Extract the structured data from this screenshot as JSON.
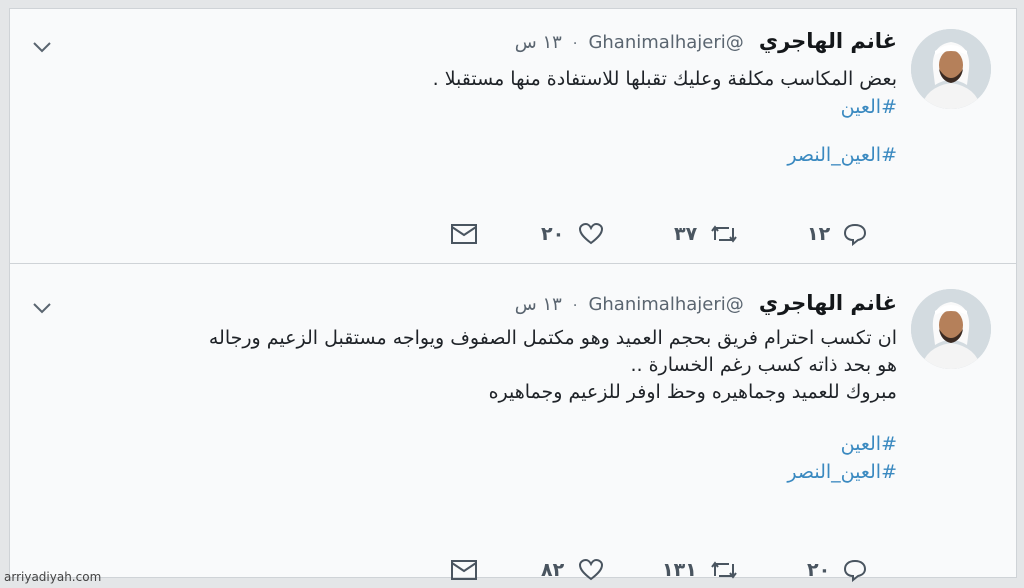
{
  "tweets": [
    {
      "name": "غانم الهاجري",
      "handle": "@Ghanimalhajeri",
      "dot": "·",
      "time": "١٣ س",
      "lines": [
        "بعض المكاسب مكلفة وعليك تقبلها للاستفادة منها مستقبلا ."
      ],
      "hashtags": [
        "#العين",
        "#العين_النصر"
      ],
      "replies": "١٢",
      "retweets": "٣٧",
      "likes": "٢٠"
    },
    {
      "name": "غانم الهاجري",
      "handle": "@Ghanimalhajeri",
      "dot": "·",
      "time": "١٣ س",
      "lines": [
        "ان تكسب احترام فريق بحجم العميد وهو مكتمل الصفوف ويواجه مستقبل الزعيم ورجاله",
        "هو بحد ذاته كسب رغم الخسارة ..",
        "مبروك للعميد وجماهيره وحظ اوفر للزعيم وجماهيره"
      ],
      "hashtags": [
        "#العين",
        "#العين_النصر"
      ],
      "replies": "٢٠",
      "retweets": "١٣١",
      "likes": "٨٢"
    }
  ],
  "icons": {
    "reply": "reply-icon",
    "retweet": "retweet-icon",
    "like": "heart-icon",
    "message": "envelope-icon",
    "caret": "chevron-down-icon"
  },
  "colors": {
    "hashtag": "#3a89c0",
    "text": "#1f2328",
    "muted": "#5a6570"
  },
  "watermark": "arriyadiyah.com"
}
